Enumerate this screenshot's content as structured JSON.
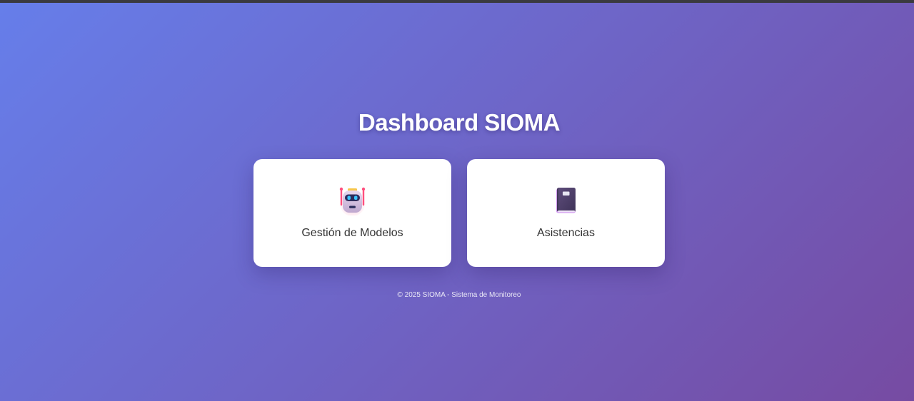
{
  "header": {
    "title": "Dashboard SIOMA"
  },
  "cards": [
    {
      "label": "Gestión de Modelos",
      "icon": "robot-icon"
    },
    {
      "label": "Asistencias",
      "icon": "notebook-icon"
    }
  ],
  "footer": {
    "text": "© 2025 SIOMA - Sistema de Monitoreo"
  },
  "colors": {
    "gradient_start": "#667eea",
    "gradient_end": "#764ba2",
    "card_background": "#ffffff",
    "card_text": "#333333"
  }
}
